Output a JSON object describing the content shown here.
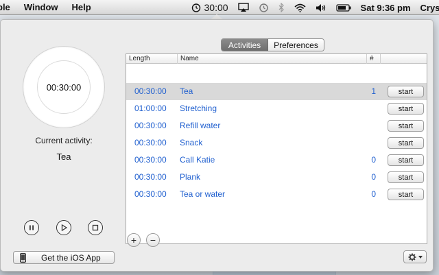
{
  "menubar": {
    "menus": [
      "ple",
      "Window",
      "Help"
    ],
    "timer": "30:00",
    "clock": "Sat 9:36 pm",
    "user": "Crysta"
  },
  "left": {
    "ring_time": "00:30:00",
    "current_label": "Current activity:",
    "current_value": "Tea",
    "ios_button": "Get the iOS App"
  },
  "tabs": [
    {
      "label": "Activities",
      "active": true
    },
    {
      "label": "Preferences",
      "active": false
    }
  ],
  "table": {
    "headers": {
      "length": "Length",
      "name": "Name",
      "count": "#"
    },
    "rows": [
      {
        "length": "00:30:00",
        "name": "Tea",
        "count": "1",
        "start": "start",
        "selected": true
      },
      {
        "length": "01:00:00",
        "name": "Stretching",
        "count": "",
        "start": "start"
      },
      {
        "length": "00:30:00",
        "name": "Refill water",
        "count": "",
        "start": "start"
      },
      {
        "length": "00:30:00",
        "name": "Snack",
        "count": "",
        "start": "start"
      },
      {
        "length": "00:30:00",
        "name": "Call Katie",
        "count": "0",
        "start": "start"
      },
      {
        "length": "00:30:00",
        "name": "Plank",
        "count": "0",
        "start": "start"
      },
      {
        "length": "00:30:00",
        "name": "Tea or water",
        "count": "0",
        "start": "start"
      }
    ]
  },
  "buttons": {
    "add": "+",
    "remove": "−"
  },
  "icons": {
    "timer": "stopwatch-icon",
    "airplay": "airplay-icon",
    "time_machine": "time-machine-icon",
    "bluetooth": "bluetooth-icon",
    "wifi": "wifi-icon",
    "volume": "volume-icon",
    "battery": "battery-icon",
    "pause": "pause-icon",
    "play": "play-icon",
    "stop": "stop-icon",
    "phone": "phone-icon",
    "gear": "gear-icon"
  },
  "colors": {
    "accent": "#1f5fcf",
    "selected_row": "#d9d9d9"
  }
}
